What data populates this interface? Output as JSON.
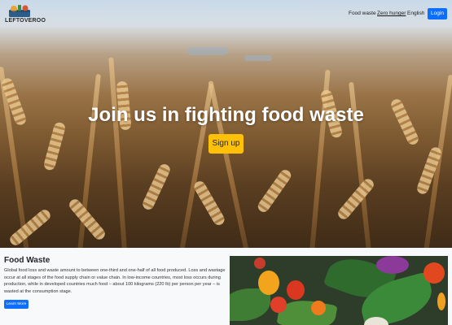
{
  "brand": {
    "name": "LEFTOVEROO"
  },
  "nav": {
    "links": [
      "Food waste",
      "Zero hunger",
      "English"
    ],
    "login": "Login"
  },
  "hero": {
    "title": "Join us in fighting food waste",
    "cta": "Sign up"
  },
  "section": {
    "title": "Food Waste",
    "text": "Global food loss and waste amount to between one-third and one-half of all food produced. Loss and wastage occur at all stages of the food supply chain or value chain. In low-income countries, most loss occurs during production, while in developed countries much food – about 100 kilograms (220 lb) per person per year – is wasted at the consumption stage.",
    "button": "Learn More"
  },
  "colors": {
    "primary": "#0d6efd",
    "warning": "#ffc107"
  }
}
